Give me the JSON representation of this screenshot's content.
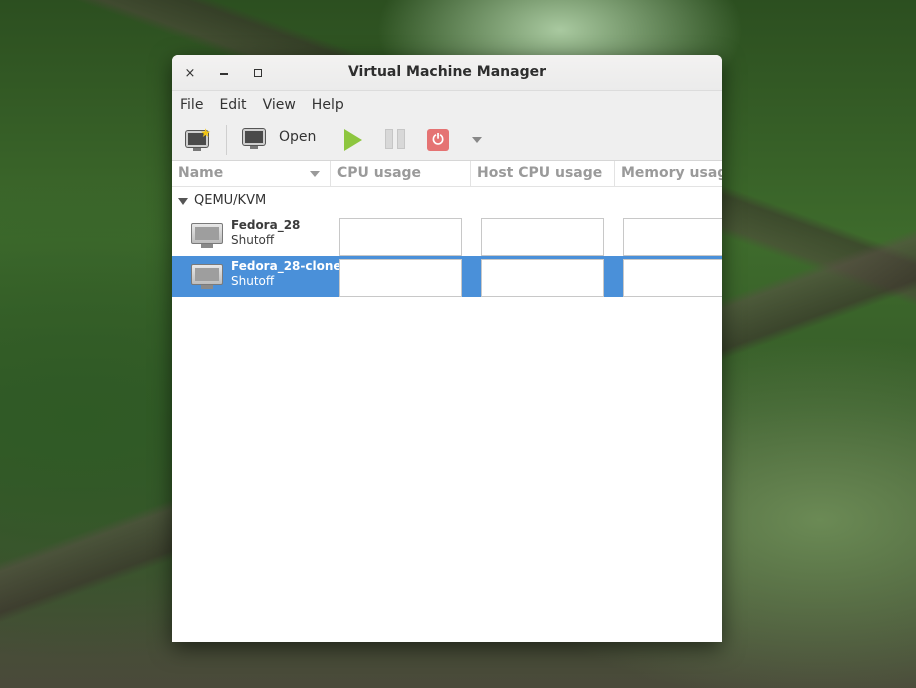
{
  "window": {
    "title": "Virtual Machine Manager",
    "close_glyph": "×"
  },
  "menubar": {
    "items": [
      "File",
      "Edit",
      "View",
      "Help"
    ]
  },
  "toolbar": {
    "new_vm_icon": "new-vm-icon",
    "open_label": "Open",
    "run_icon": "play-icon",
    "pause_icon": "pause-icon",
    "shutdown_icon": "power-icon",
    "shutdown_menu_icon": "chevron-down-icon"
  },
  "columns": {
    "name": "Name",
    "cpu": "CPU usage",
    "host_cpu": "Host CPU usage",
    "memory": "Memory usage"
  },
  "connection": {
    "label": "QEMU/KVM",
    "vms": [
      {
        "name": "Fedora_28",
        "status": "Shutoff",
        "selected": false
      },
      {
        "name": "Fedora_28-clone",
        "status": "Shutoff",
        "selected": true
      }
    ]
  },
  "colors": {
    "selection": "#4a90d9",
    "play": "#8dc63f",
    "power": "#e57373"
  }
}
